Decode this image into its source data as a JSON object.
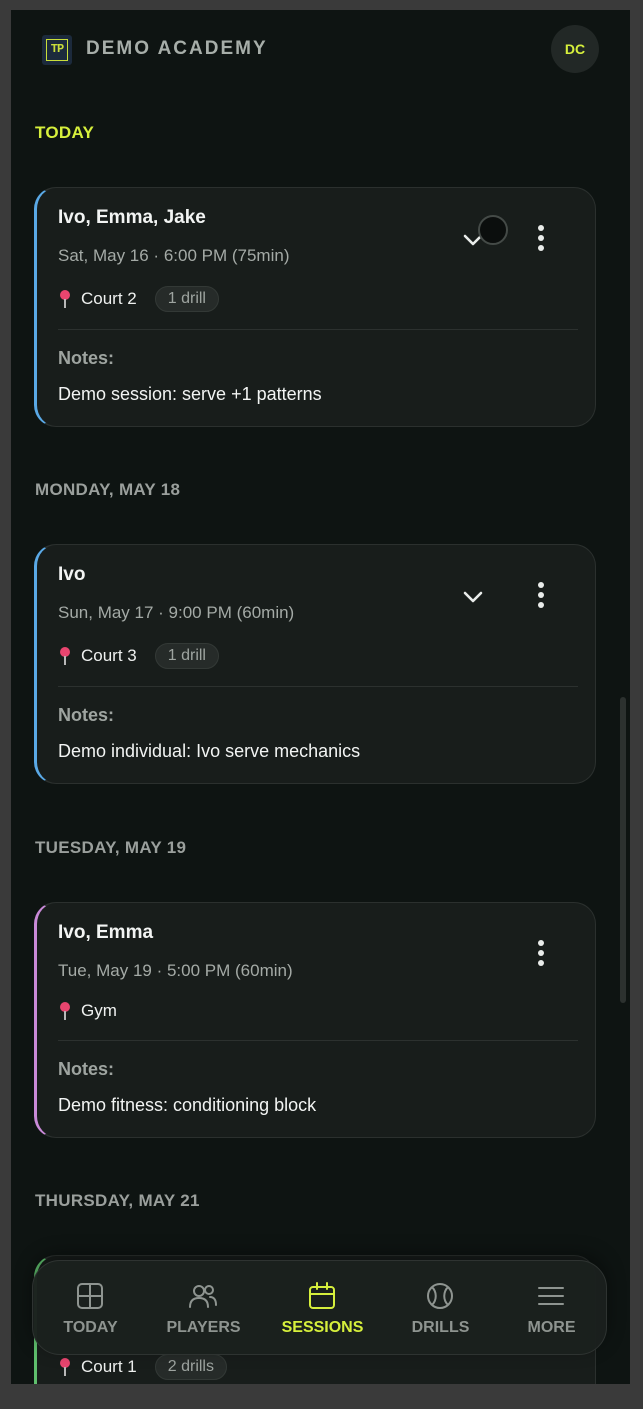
{
  "header": {
    "logo_text": "TP",
    "brand": "DEMO ACADEMY",
    "avatar_initials": "DC"
  },
  "sections": {
    "today": "TODAY",
    "monday": "MONDAY, MAY 18",
    "tuesday": "TUESDAY, MAY 19",
    "thursday": "THURSDAY, MAY 21"
  },
  "sessions": [
    {
      "names": "Ivo, Emma, Jake",
      "when": "Sat, May 16 · 6:00 PM (75min)",
      "location": "Court 2",
      "drills": "1 drill",
      "notes_label": "Notes:",
      "notes": "Demo session: serve +1 patterns",
      "accent": "#5aa9e6"
    },
    {
      "names": "Ivo",
      "when": "Sun, May 17 · 9:00 PM (60min)",
      "location": "Court 3",
      "drills": "1 drill",
      "notes_label": "Notes:",
      "notes": "Demo individual: Ivo serve mechanics",
      "accent": "#5aa9e6"
    },
    {
      "names": "Ivo, Emma",
      "when": "Tue, May 19 · 5:00 PM (60min)",
      "location": "Gym",
      "notes_label": "Notes:",
      "notes": "Demo fitness: conditioning block",
      "accent": "#c98ad8"
    },
    {
      "location": "Court 1",
      "drills": "2 drills",
      "accent": "#5fbf6d"
    }
  ],
  "tabs": [
    {
      "label": "TODAY",
      "icon": "grid-icon"
    },
    {
      "label": "PLAYERS",
      "icon": "users-icon"
    },
    {
      "label": "SESSIONS",
      "icon": "calendar-icon",
      "active": true
    },
    {
      "label": "DRILLS",
      "icon": "tennis-ball-icon"
    },
    {
      "label": "MORE",
      "icon": "menu-icon"
    }
  ],
  "colors": {
    "accent": "#d6ef3c",
    "background": "#0e1412",
    "card": "#181d1b"
  }
}
